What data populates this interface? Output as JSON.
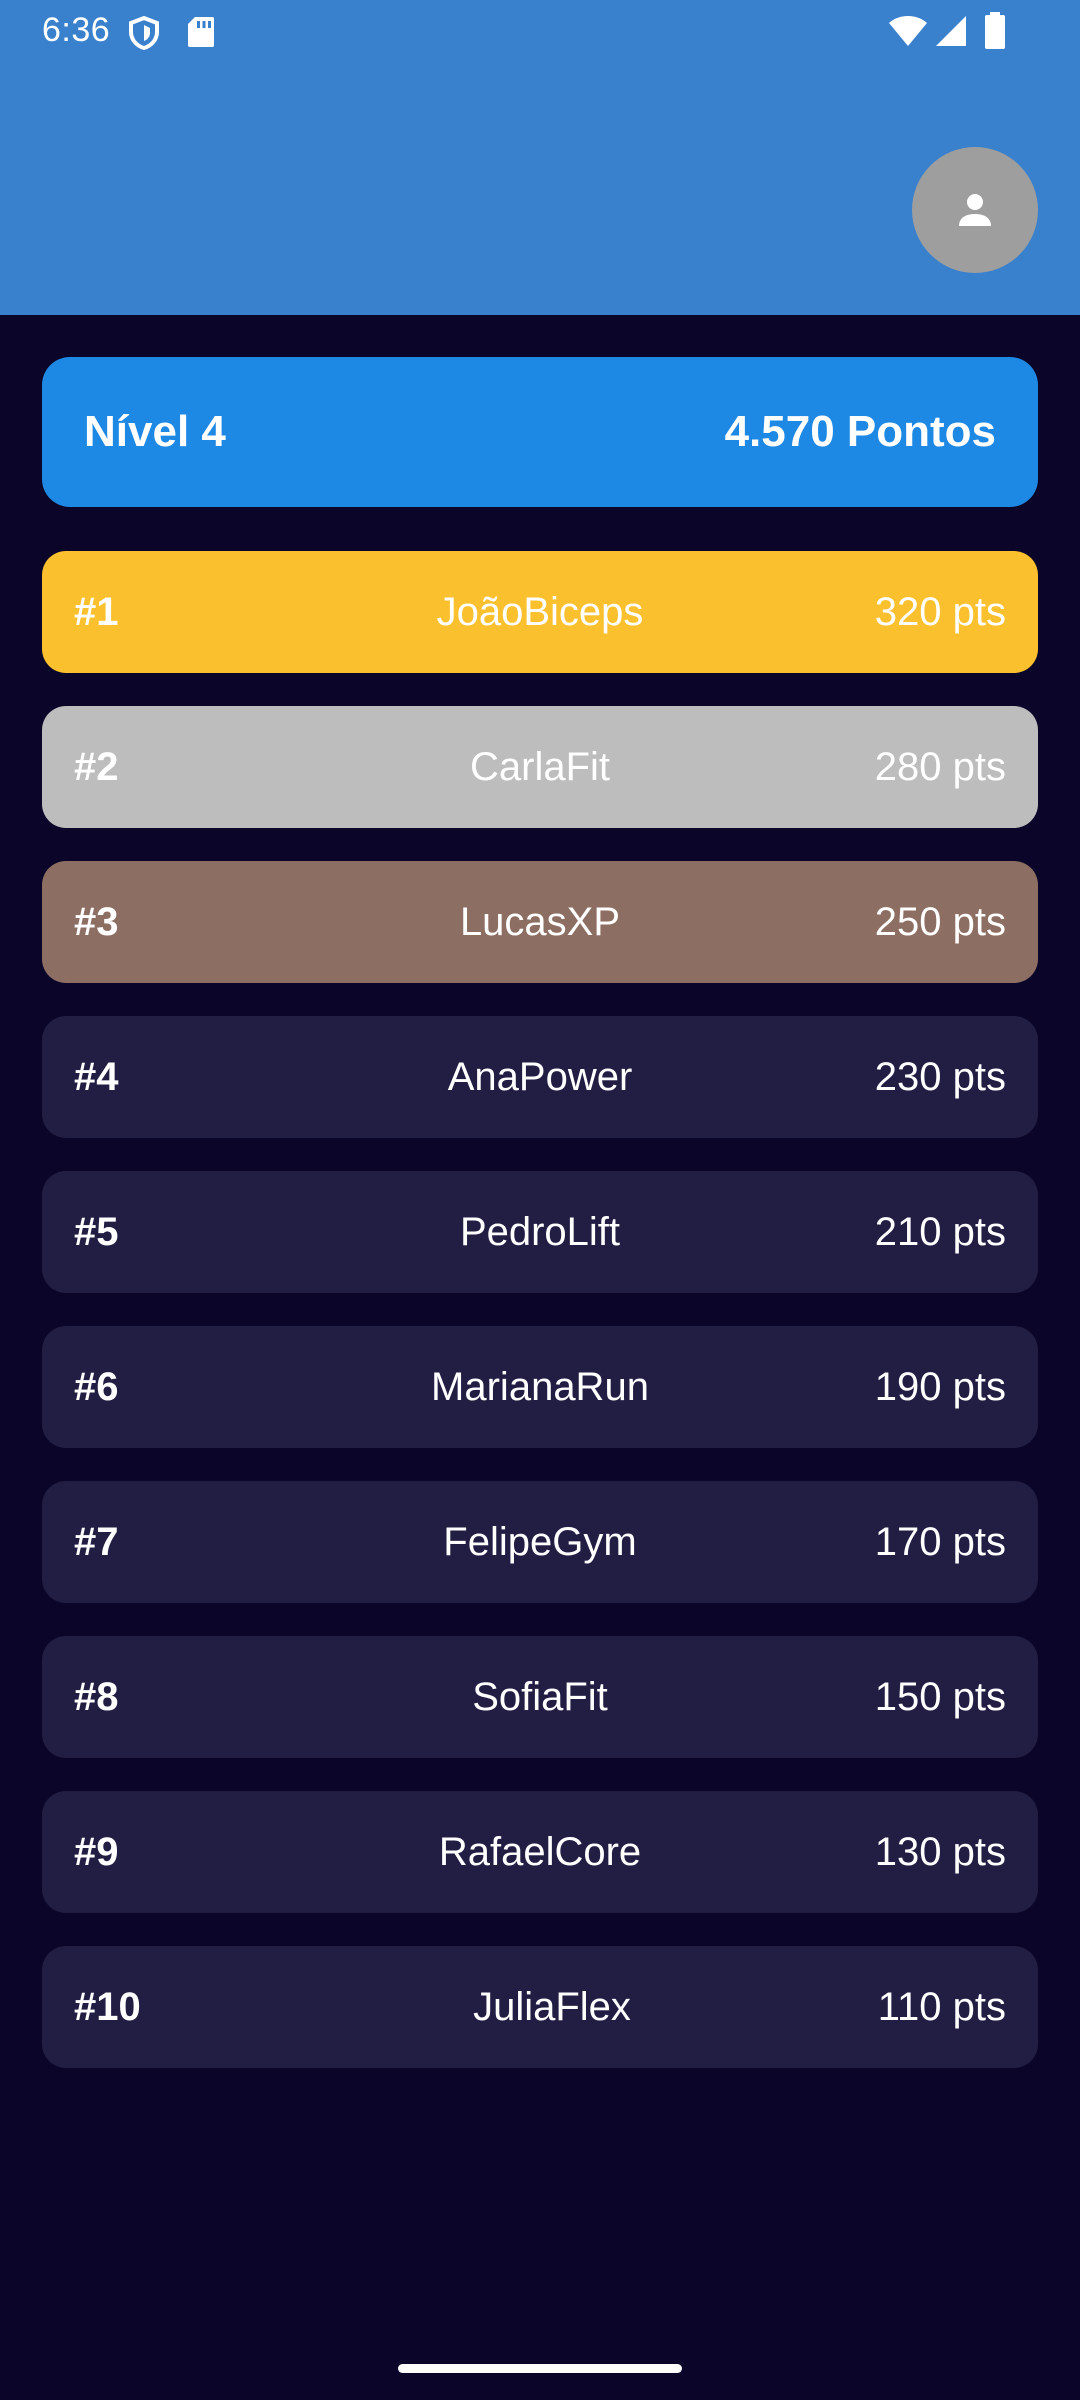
{
  "status_bar": {
    "time": "6:36",
    "left_icons": [
      "shield-icon",
      "sd-card-icon"
    ],
    "right_icons": [
      "wifi-icon",
      "cellular-signal-icon",
      "battery-icon"
    ]
  },
  "header": {
    "color": "#3a81cd",
    "avatar_icon": "person-icon"
  },
  "level_card": {
    "level": "Nível 4",
    "points": "4.570 Pontos",
    "color": "#1e88e5"
  },
  "ranking": [
    {
      "position": "#1",
      "name": "JoãoBiceps",
      "points": "320 pts",
      "tier": "gold"
    },
    {
      "position": "#2",
      "name": "CarlaFit",
      "points": "280 pts",
      "tier": "silver"
    },
    {
      "position": "#3",
      "name": "LucasXP",
      "points": "250 pts",
      "tier": "bronze"
    },
    {
      "position": "#4",
      "name": "AnaPower",
      "points": "230 pts",
      "tier": "default"
    },
    {
      "position": "#5",
      "name": "PedroLift",
      "points": "210 pts",
      "tier": "default"
    },
    {
      "position": "#6",
      "name": "MarianaRun",
      "points": "190 pts",
      "tier": "default"
    },
    {
      "position": "#7",
      "name": "FelipeGym",
      "points": "170 pts",
      "tier": "default"
    },
    {
      "position": "#8",
      "name": "SofiaFit",
      "points": "150 pts",
      "tier": "default"
    },
    {
      "position": "#9",
      "name": "RafaelCore",
      "points": "130 pts",
      "tier": "default"
    },
    {
      "position": "#10",
      "name": "JuliaFlex",
      "points": "110 pts",
      "tier": "default"
    }
  ],
  "colors": {
    "background": "#0b0629",
    "row_default": "#221d43",
    "gold": "#fbc02d",
    "silver": "#bdbdbd",
    "bronze": "#8d6e63"
  }
}
